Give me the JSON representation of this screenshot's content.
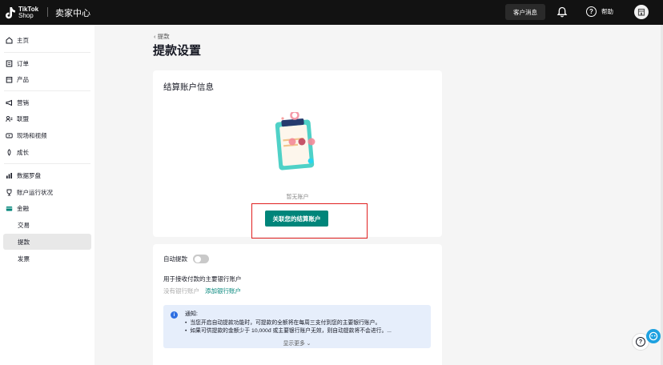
{
  "topbar": {
    "brand_line1": "TikTok",
    "brand_line2": "Shop",
    "title": "卖家中心",
    "customer_msg": "客户消息",
    "help": "帮助"
  },
  "sidebar": {
    "items": [
      {
        "label": "主页",
        "icon": "home-icon"
      },
      {
        "label": "订单",
        "icon": "order-icon"
      },
      {
        "label": "产品",
        "icon": "product-icon"
      },
      {
        "label": "营销",
        "icon": "megaphone-icon"
      },
      {
        "label": "联盟",
        "icon": "affiliate-icon"
      },
      {
        "label": "现场和视频",
        "icon": "video-icon"
      },
      {
        "label": "成长",
        "icon": "growth-icon"
      },
      {
        "label": "数据罗盘",
        "icon": "data-compass-icon"
      },
      {
        "label": "账户运行状况",
        "icon": "trophy-icon"
      },
      {
        "label": "金融",
        "icon": "wallet-icon"
      }
    ],
    "sub_items": [
      "交易",
      "提款",
      "发票"
    ],
    "active": "提款"
  },
  "main": {
    "back_label": "‹ 提款",
    "page_title": "提款设置",
    "settlement_title": "结算账户信息",
    "empty_text": "暂无账户",
    "link_button": "关联您的结算账户",
    "auto_withdraw_label": "自动提款",
    "auto_withdraw_on": false,
    "bank_label": "用于接收付款的主要银行账户",
    "no_bank": "没有银行账户",
    "add_bank": "添加银行账户",
    "notice": {
      "title": "通知:",
      "lines": [
        "当您开启自动提款功能时，可提款的全额将在每周三支付到您的主要银行账户。",
        "如果可供提款的金额少于 10,000đ 或主要银行账户无效，则自动提款将不会进行。..."
      ],
      "more": "显示更多 ⌄"
    }
  },
  "colors": {
    "accent": "#00857a",
    "topbar": "#121212",
    "highlight": "#e02020",
    "notice_bg": "#e6eefb"
  }
}
